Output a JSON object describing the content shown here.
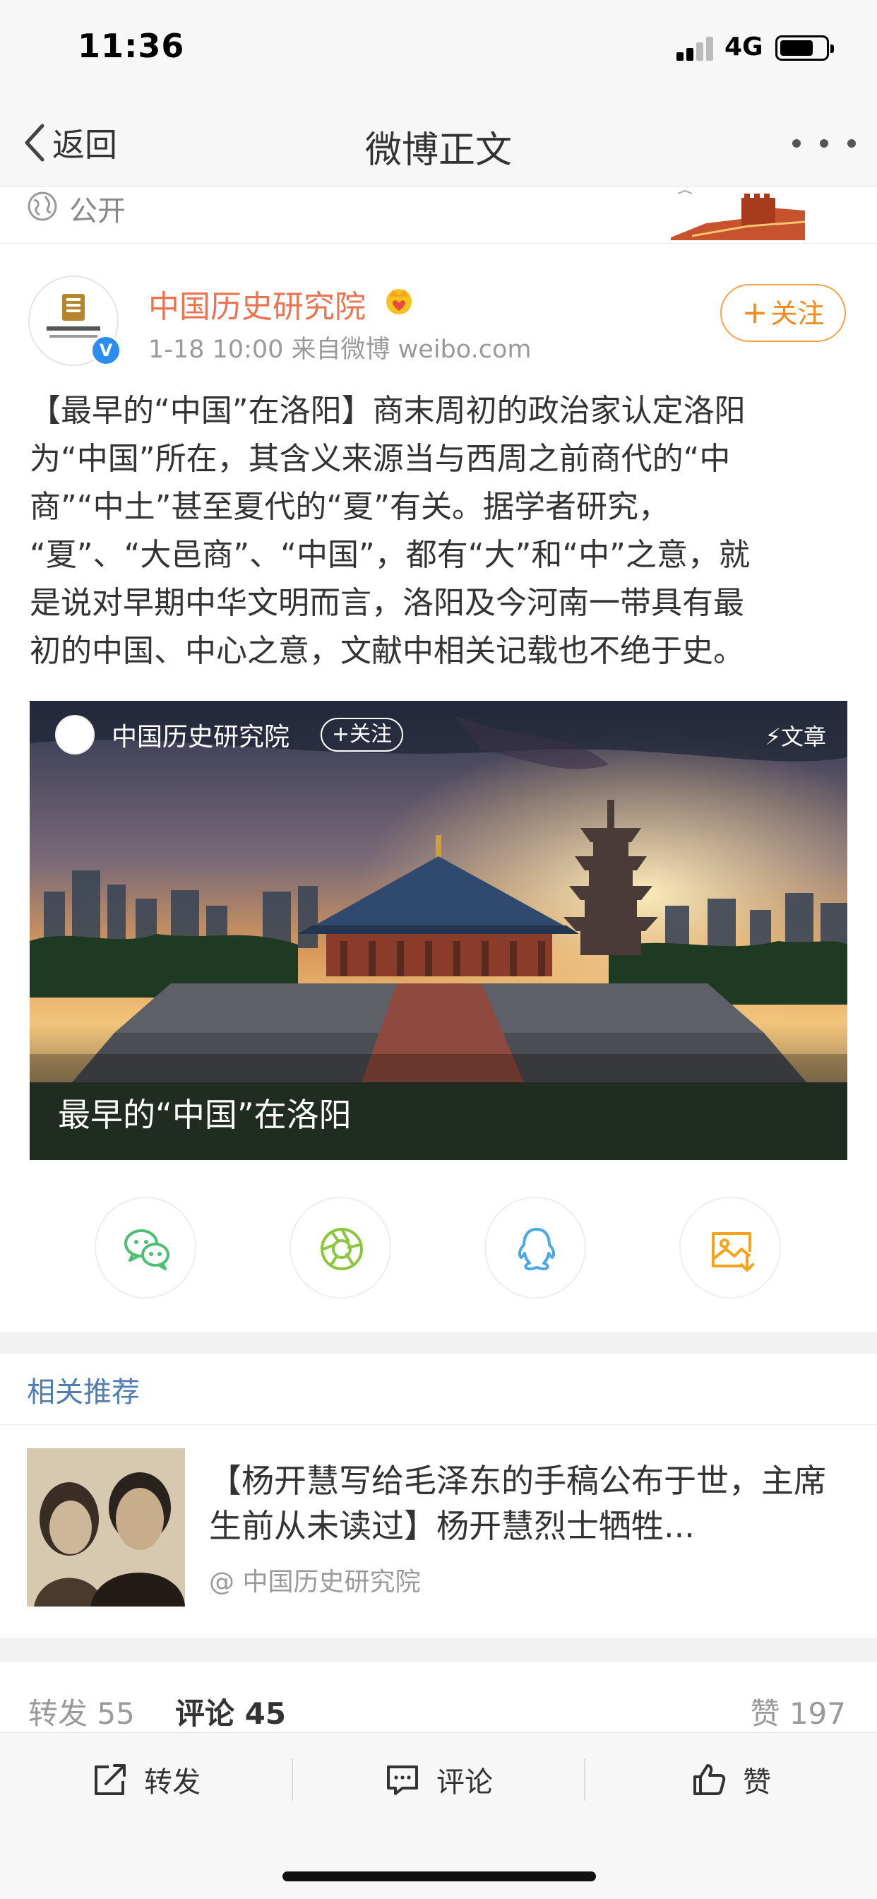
{
  "status_bar": {
    "time": "11:36",
    "network": "4G"
  },
  "nav": {
    "back_label": "返回",
    "title": "微博正文"
  },
  "visibility": {
    "label": "公开"
  },
  "post": {
    "author": "中国历史研究院",
    "meta": "1-18 10:00   来自微博 weibo.com",
    "follow_label": "关注",
    "verified_mark": "V",
    "text": "【最早的“中国”在洛阳】商末周初的政治家认定洛阳\n为“中国”所在，其含义来源当与西周之前商代的“中\n商”“中土”甚至夏代的“夏”有关。据学者研究，\n“夏”、“大邑商”、“中国”，都有“大”和“中”之意，就\n是说对早期中华文明而言，洛阳及今河南一带具有最\n初的中国、中心之意，文献中相关记载也不绝于史。"
  },
  "article_card": {
    "author": "中国历史研究院",
    "follow_label": "+关注",
    "tag": "⚡文章",
    "title": "最早的“中国”在洛阳"
  },
  "share": [
    {
      "icon": "wechat-icon",
      "color": "#4cbf72"
    },
    {
      "icon": "moments-icon",
      "color": "#8cc63f"
    },
    {
      "icon": "qq-icon",
      "color": "#4aa8e8"
    },
    {
      "icon": "save-image-icon",
      "color": "#f5a31a"
    }
  ],
  "related": {
    "heading": "相关推荐",
    "title": "【杨开慧写给毛泽东的手稿公布于世，主席生前从未读过】杨开慧烈士牺牲...",
    "source": "@ 中国历史研究院"
  },
  "counts": {
    "forward": "转发 55",
    "comment": "评论 45",
    "like": "赞 197"
  },
  "actions": {
    "forward": "转发",
    "comment": "评论",
    "like": "赞"
  },
  "colors": {
    "accent_orange": "#eb7350",
    "link_blue": "#507daf",
    "verified_blue": "#2d8cf0"
  }
}
